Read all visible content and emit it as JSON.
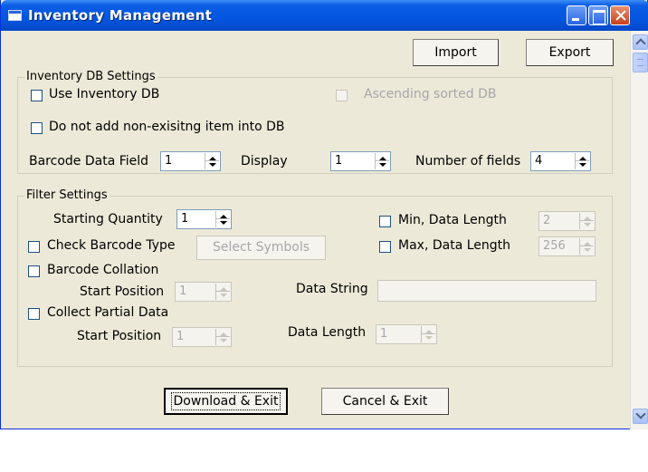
{
  "window": {
    "title": "Inventory Management"
  },
  "toolbar": {
    "import_label": "Import",
    "export_label": "Export"
  },
  "inventory_db": {
    "group_label": "Inventory DB Settings",
    "use_inventory_db": {
      "label": "Use Inventory DB",
      "checked": false
    },
    "ascending_sorted_db": {
      "label": "Ascending sorted DB",
      "checked": false,
      "enabled": false
    },
    "do_not_add": {
      "label": "Do not add non-exisitng item into DB",
      "checked": false
    },
    "barcode_data_field": {
      "label": "Barcode Data Field",
      "value": "1"
    },
    "display": {
      "label": "Display",
      "value": "1"
    },
    "number_of_fields": {
      "label": "Number of fields",
      "value": "4"
    }
  },
  "filter": {
    "group_label": "Filter Settings",
    "starting_quantity": {
      "label": "Starting Quantity",
      "value": "1"
    },
    "min_data_length": {
      "label": "Min, Data Length",
      "value": "2",
      "checked": false
    },
    "max_data_length": {
      "label": "Max, Data Length",
      "value": "256",
      "checked": false
    },
    "check_barcode_type": {
      "label": "Check Barcode Type",
      "checked": false
    },
    "select_symbols_label": "Select Symbols",
    "barcode_collation": {
      "label": "Barcode Collation",
      "checked": false
    },
    "collation_start_position": {
      "label": "Start Position",
      "value": "1"
    },
    "data_string": {
      "label": "Data String",
      "value": ""
    },
    "collect_partial_data": {
      "label": "Collect Partial Data",
      "checked": false
    },
    "partial_start_position": {
      "label": "Start Position",
      "value": "1"
    },
    "data_length": {
      "label": "Data Length",
      "value": "1"
    }
  },
  "footer": {
    "download_exit_label": "Download & Exit",
    "cancel_exit_label": "Cancel & Exit"
  }
}
